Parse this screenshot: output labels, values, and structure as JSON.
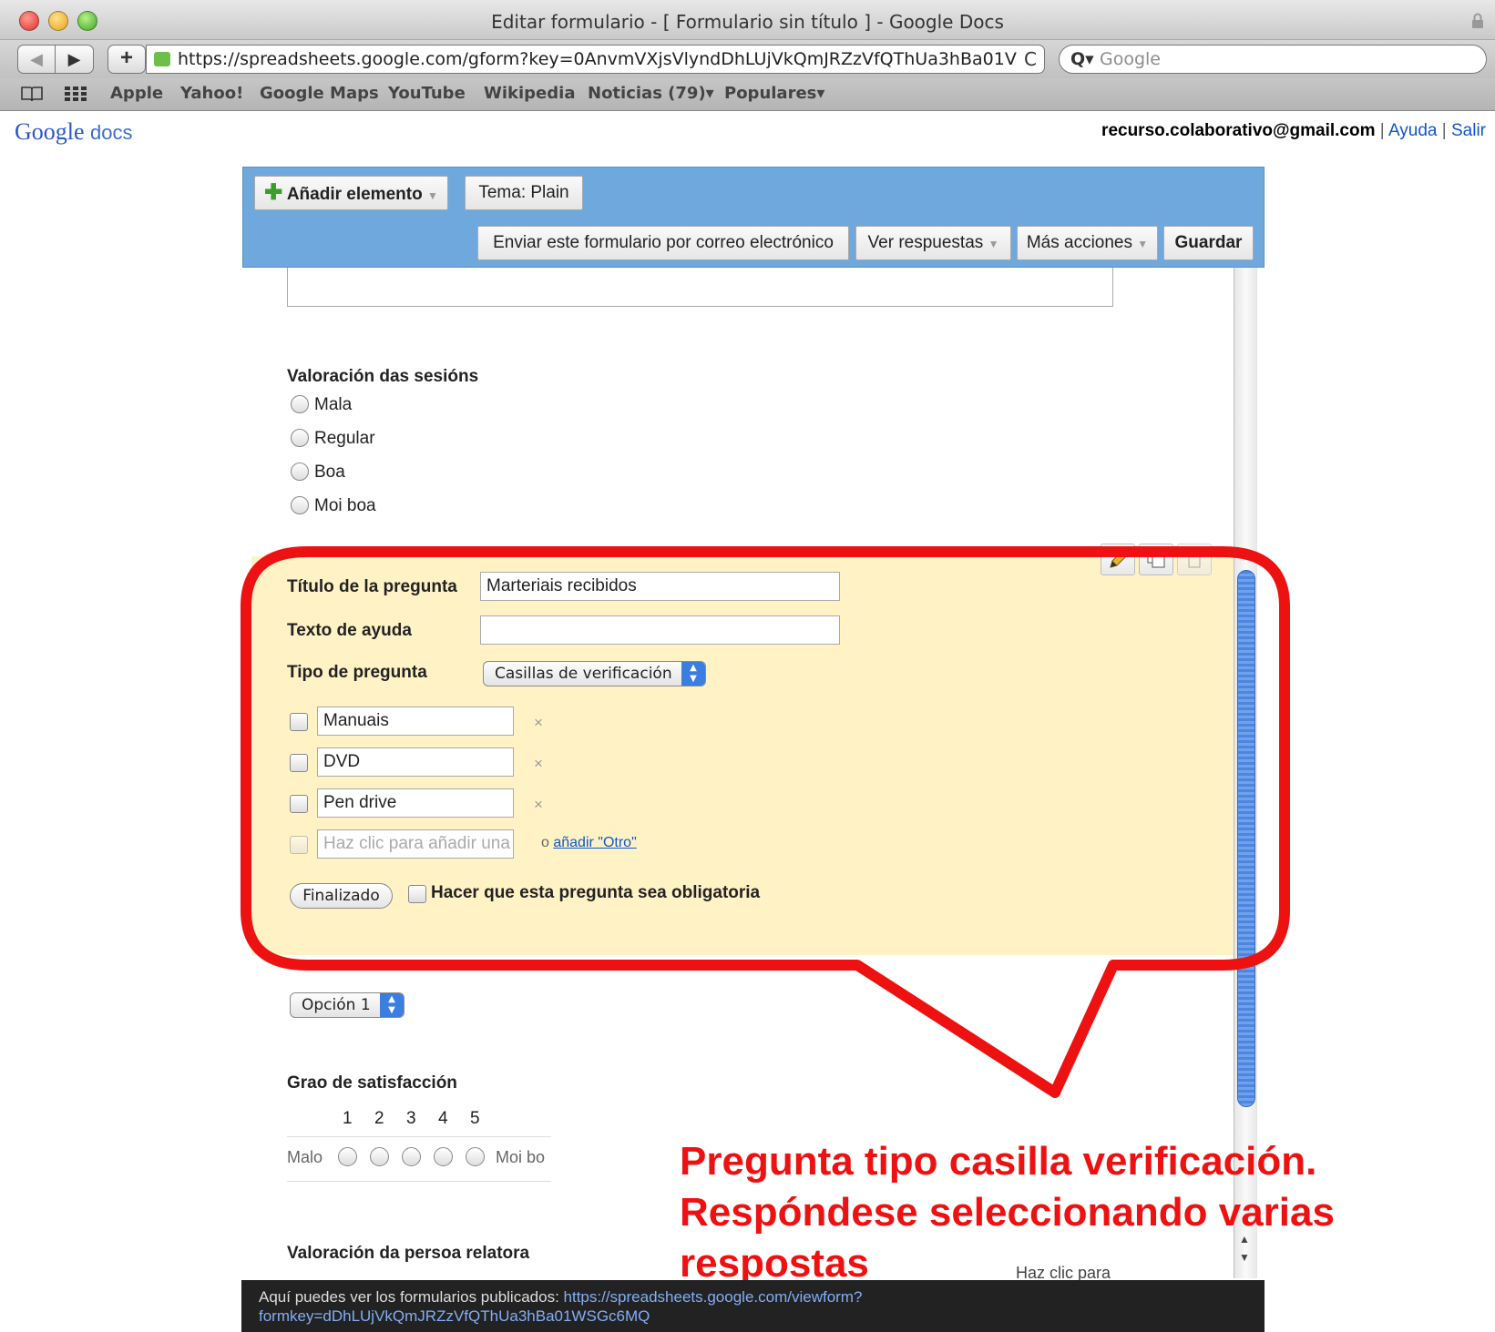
{
  "window": {
    "title": "Editar formulario - [ Formulario sin título ] - Google Docs"
  },
  "browser": {
    "url": "https://spreadsheets.google.com/gform?key=0AnvmVXjsVlyndDhLUjVkQmJRZzVfQThUa3hBa01V",
    "search_placeholder": "Google",
    "back": "◀",
    "forward": "▶",
    "add": "+",
    "reload": "C",
    "bookmarks": [
      "Apple",
      "Yahoo!",
      "Google Maps",
      "YouTube",
      "Wikipedia",
      "Noticias (79)▾",
      "Populares▾"
    ]
  },
  "header": {
    "logo_google": "Google",
    "logo_docs": "docs",
    "email": "recurso.colaborativo@gmail.com",
    "help": "Ayuda",
    "sign_out": "Salir",
    "separator": "|"
  },
  "editor": {
    "add_element": "Añadir elemento",
    "theme": "Tema:  Plain",
    "send_email": "Enviar este formulario por correo electrónico",
    "view_responses": "Ver respuestas",
    "more_actions": "Más acciones",
    "save": "Guardar"
  },
  "question_sessions": {
    "title": "Valoración das sesións",
    "options": [
      "Mala",
      "Regular",
      "Boa",
      "Moi boa"
    ]
  },
  "edit_panel": {
    "title_label": "Título de la pregunta",
    "title_value": "Marteriais recibidos",
    "help_label": "Texto de ayuda",
    "help_value": "",
    "type_label": "Tipo de pregunta",
    "type_value": "Casillas de verificación",
    "options": [
      "Manuais",
      "DVD",
      "Pen drive"
    ],
    "add_placeholder": "Haz clic para añadir una",
    "or_text": "o",
    "add_other": "añadir \"Otro\"",
    "remove": "×",
    "done": "Finalizado",
    "required": "Hacer que esta pregunta sea obligatoria"
  },
  "option_select": "Opción 1",
  "question_satisfaction": {
    "title": "Grao de satisfacción",
    "scale": [
      "1",
      "2",
      "3",
      "4",
      "5"
    ],
    "low_label": "Malo",
    "high_label": "Moi bo"
  },
  "question_speaker": {
    "title": "Valoración da persoa relatora",
    "hint": "Haz clic para"
  },
  "annotation": {
    "text": "Pregunta tipo casilla verificación. Respóndese seleccionando varias respostas",
    "color": "#ee1111"
  },
  "banner": {
    "text": "Aquí puedes ver los formularios publicados:",
    "link": "https://spreadsheets.google.com/viewform?formkey=dDhLUjVkQmJRZzVfQThUa3hBa01WSGc6MQ"
  }
}
